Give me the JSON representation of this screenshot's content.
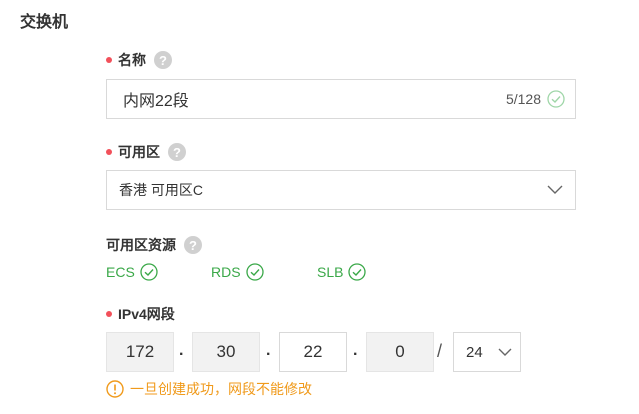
{
  "section_title": "交换机",
  "name_field": {
    "label": "名称",
    "help": "?",
    "value": "内网22段",
    "counter": "5/128"
  },
  "zone_field": {
    "label": "可用区",
    "help": "?",
    "value": "香港 可用区C"
  },
  "resources": {
    "label": "可用区资源",
    "help": "?",
    "items": [
      "ECS",
      "RDS",
      "SLB"
    ]
  },
  "ipv4": {
    "label": "IPv4网段",
    "octets": [
      "172",
      "30",
      "22",
      "0"
    ],
    "separator": ".",
    "slash": "/",
    "mask": "24",
    "warning": "一旦创建成功，网段不能修改"
  },
  "colors": {
    "required_dot": "#f2505a",
    "success": "#3aa848",
    "warning": "#f09a1b"
  }
}
